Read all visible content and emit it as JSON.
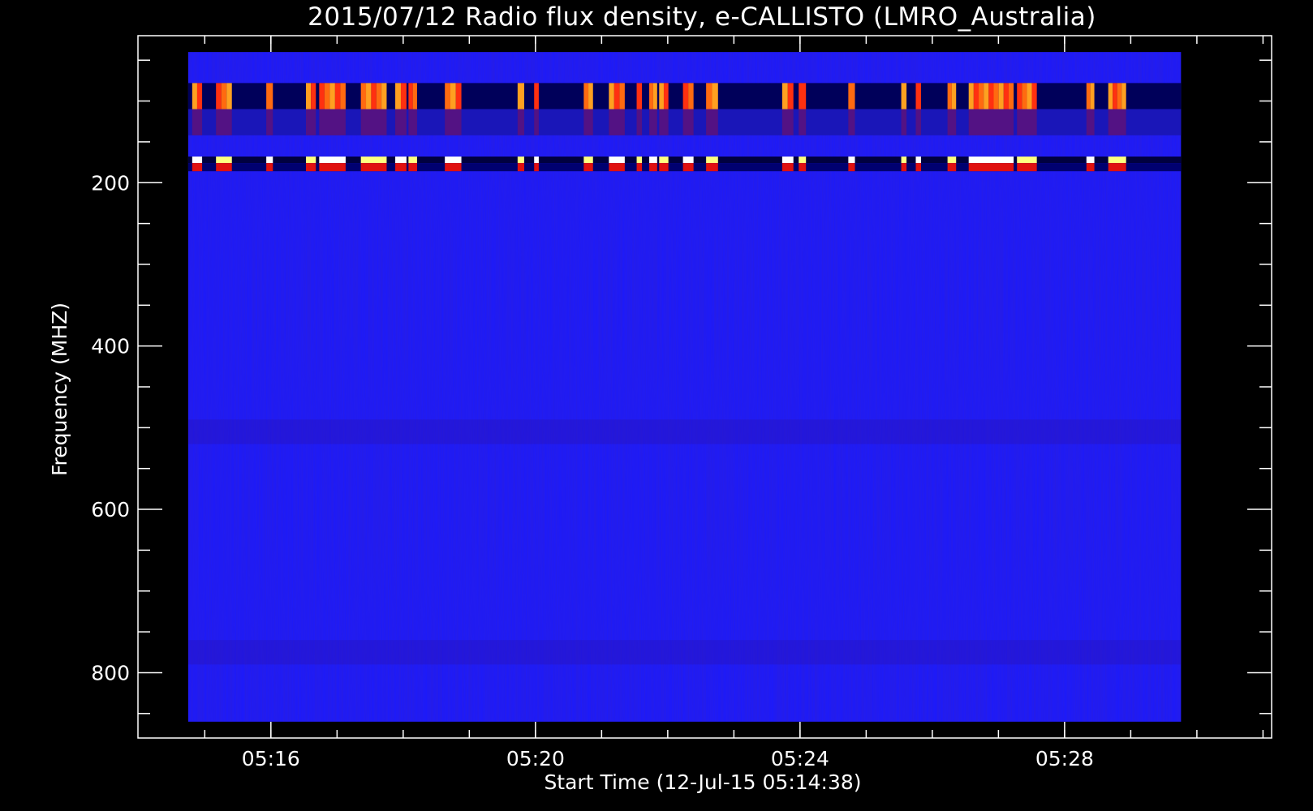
{
  "chart_data": {
    "type": "heatmap",
    "title": "2015/07/12  Radio flux density, e-CALLISTO (LMRO_Australia)",
    "xlabel": "Start Time (12-Jul-15 05:14:38)",
    "ylabel": "Frequency (MHZ)",
    "x_ticks": [
      "05:16",
      "05:20",
      "05:24",
      "05:28"
    ],
    "y_ticks": [
      "200",
      "400",
      "600",
      "800"
    ],
    "xlim_minutes": [
      -0.64,
      16.5
    ],
    "data_extent_minutes": [
      0.12,
      15.13
    ],
    "x_tick_minutes": [
      1.37,
      5.37,
      9.37,
      13.37
    ],
    "ylim_mhz": [
      20,
      880
    ],
    "data_extent_mhz": [
      40,
      860
    ],
    "y_tick_mhz": [
      200,
      400,
      600,
      800
    ],
    "y_reversed": true,
    "colormap": "red-temperature (blue background, orange/yellow/white high)",
    "background_color": "#1a1aff",
    "interference_bands_mhz": [
      [
        78,
        110
      ],
      [
        110,
        142
      ],
      [
        168,
        176
      ],
      [
        176,
        186
      ]
    ],
    "burst_intervals_minutes": [
      [
        0.18,
        0.33
      ],
      [
        0.54,
        0.78
      ],
      [
        1.3,
        1.4
      ],
      [
        1.9,
        2.05
      ],
      [
        2.1,
        2.5
      ],
      [
        2.73,
        3.12
      ],
      [
        3.25,
        3.42
      ],
      [
        3.45,
        3.58
      ],
      [
        4.0,
        4.25
      ],
      [
        5.1,
        5.2
      ],
      [
        5.35,
        5.42
      ],
      [
        6.1,
        6.24
      ],
      [
        6.48,
        6.72
      ],
      [
        6.9,
        6.98
      ],
      [
        7.09,
        7.21
      ],
      [
        7.24,
        7.38
      ],
      [
        7.6,
        7.76
      ],
      [
        7.95,
        8.13
      ],
      [
        9.1,
        9.27
      ],
      [
        9.35,
        9.46
      ],
      [
        10.1,
        10.2
      ],
      [
        10.9,
        10.98
      ],
      [
        11.12,
        11.2
      ],
      [
        11.6,
        11.73
      ],
      [
        11.92,
        12.6
      ],
      [
        12.65,
        12.95
      ],
      [
        13.7,
        13.82
      ],
      [
        14.03,
        14.3
      ]
    ]
  }
}
